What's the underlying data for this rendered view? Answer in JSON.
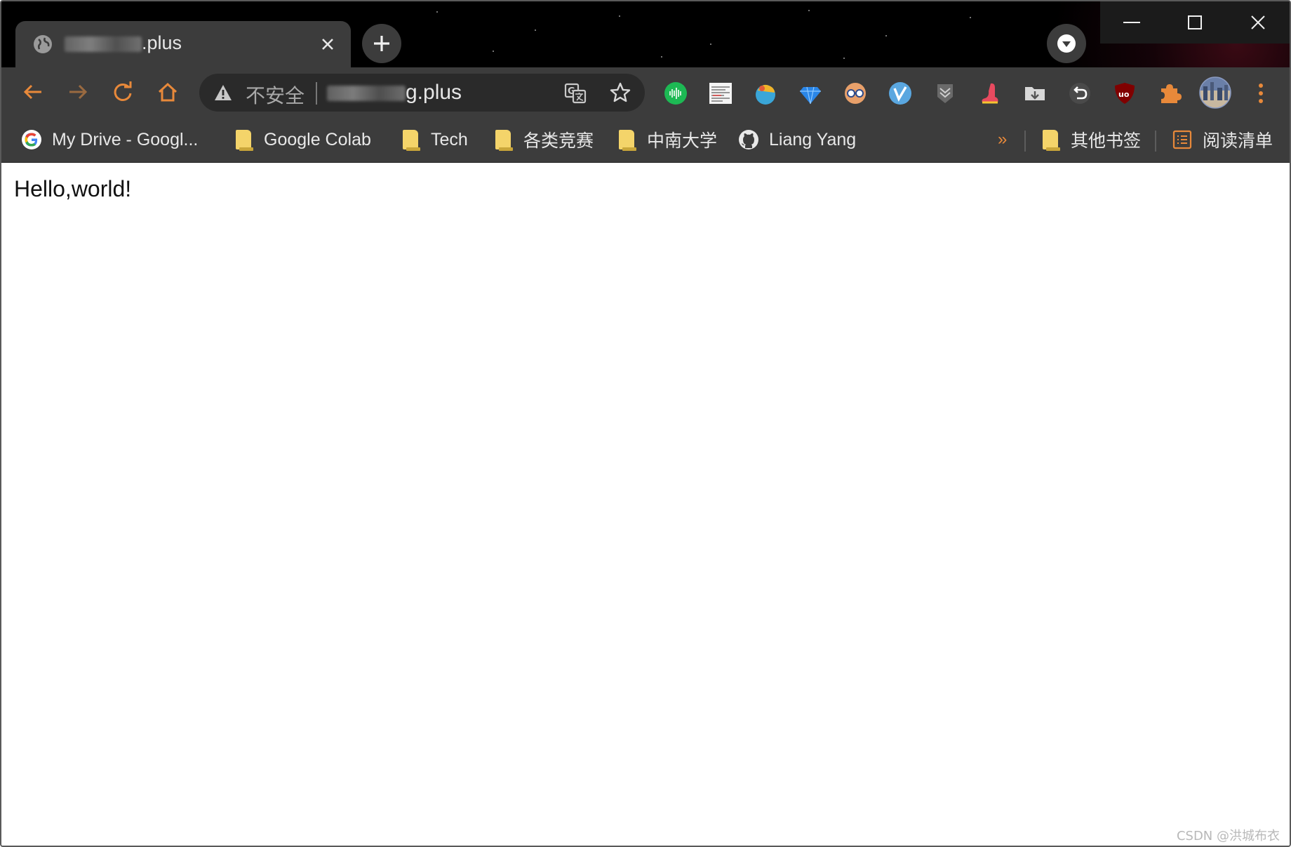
{
  "tab": {
    "title_visible_suffix": ".plus",
    "close_symbol": "✕"
  },
  "new_tab_symbol": "+",
  "window_controls": {
    "minimize": "—",
    "maximize": "☐",
    "close": "✕"
  },
  "toolbar": {
    "security_label": "不安全",
    "url_visible_suffix": "g.plus"
  },
  "extensions": [
    "spotify-like-audio-icon",
    "reader-view-icon",
    "ball-icon",
    "diamond-icon",
    "glasses-icon",
    "v-icon",
    "chevron-shield-icon",
    "boot-icon",
    "folder-download-icon",
    "undo-arrow-icon",
    "ublock-origin-icon",
    "puzzle-extensions-icon"
  ],
  "bookmarks": {
    "items": [
      {
        "label": "My Drive - Googl...",
        "icon": "google-icon"
      },
      {
        "label": "Google Colab",
        "icon": "folder-icon"
      },
      {
        "label": "Tech",
        "icon": "folder-icon"
      },
      {
        "label": "各类竞赛",
        "icon": "folder-icon"
      },
      {
        "label": "中南大学",
        "icon": "folder-icon"
      },
      {
        "label": "Liang Yang",
        "icon": "github-icon"
      }
    ],
    "overflow": "»",
    "other": "其他书签",
    "reading_list": "阅读清单"
  },
  "page": {
    "body_text": "Hello,world!"
  },
  "watermark": "CSDN @洪城布衣",
  "colors": {
    "chrome_dark": "#3c3c3c",
    "accent_orange": "#e8893a",
    "folder_yellow": "#f4d46a"
  }
}
